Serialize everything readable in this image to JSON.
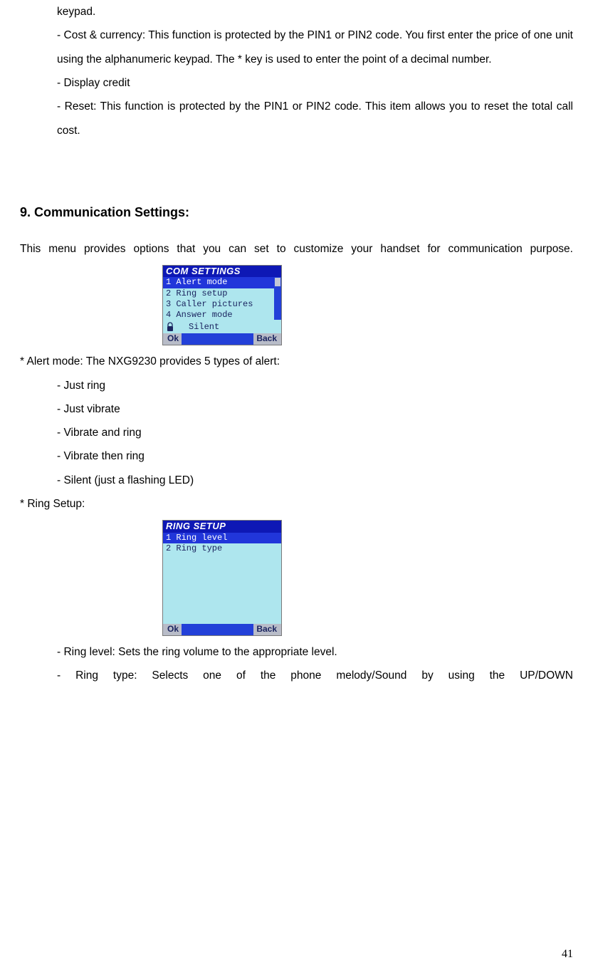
{
  "top": {
    "keypad": "keypad.",
    "cost_currency": "- Cost & currency: This function is protected by the PIN1 or PIN2 code. You first enter the price of one unit using the alphanumeric keypad. The * key is used to enter the point of a decimal number.",
    "display_credit": "- Display credit",
    "reset": "- Reset: This function is protected by the PIN1 or PIN2 code. This item allows you to reset the total call cost."
  },
  "section": {
    "title": "9. Communication Settings:",
    "intro": "This menu provides options that you can set to customize your handset for communication purpose."
  },
  "com_screen": {
    "title": "COM SETTINGS",
    "items": [
      "1 Alert mode",
      "2 Ring setup",
      "3 Caller pictures",
      "4 Answer mode"
    ],
    "status": "Silent",
    "left": "Ok",
    "right": "Back"
  },
  "alert_mode": {
    "heading": "* Alert mode: The NXG9230 provides 5 types of alert:",
    "items": [
      "- Just ring",
      "- Just vibrate",
      "- Vibrate and ring",
      "- Vibrate then ring",
      "- Silent (just a flashing LED)"
    ]
  },
  "ring_setup_heading": "* Ring Setup:",
  "ring_screen": {
    "title": "RING SETUP",
    "items": [
      "1 Ring level",
      "2 Ring type"
    ],
    "left": "Ok",
    "right": "Back"
  },
  "ring_details": {
    "level": "- Ring level: Sets the ring volume to the appropriate level.",
    "type": "- Ring type: Selects one of the phone melody/Sound by using the UP/DOWN"
  },
  "page_number": "41"
}
